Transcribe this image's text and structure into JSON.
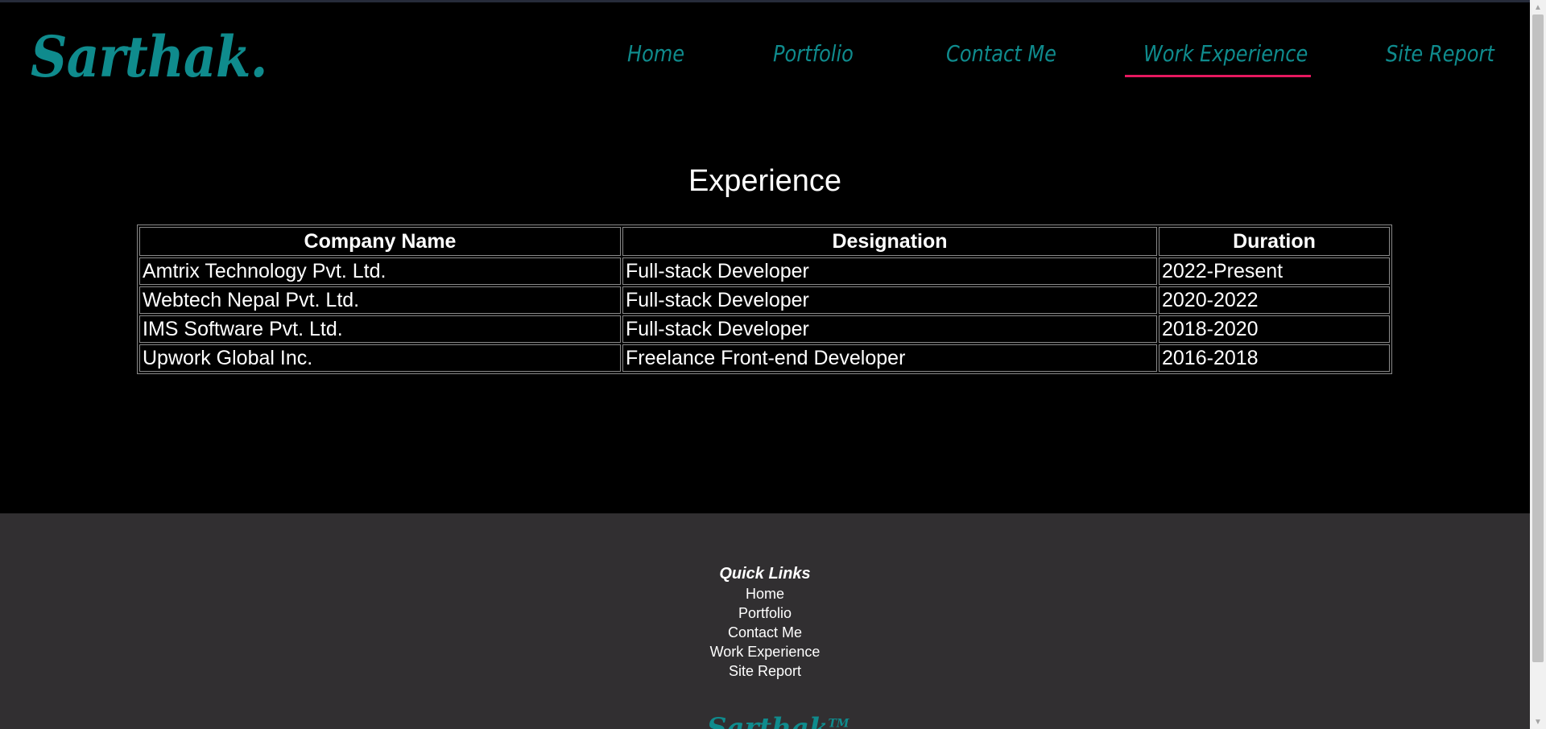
{
  "header": {
    "logo": "Sarthak.",
    "nav": [
      {
        "label": "Home"
      },
      {
        "label": "Portfolio"
      },
      {
        "label": "Contact Me"
      },
      {
        "label": "Work Experience",
        "active": true
      },
      {
        "label": "Site Report"
      }
    ]
  },
  "main": {
    "title": "Experience",
    "table": {
      "headers": [
        "Company Name",
        "Designation",
        "Duration"
      ],
      "rows": [
        [
          "Amtrix Technology Pvt. Ltd.",
          "Full-stack Developer",
          "2022-Present"
        ],
        [
          "Webtech Nepal Pvt. Ltd.",
          "Full-stack Developer",
          "2020-2022"
        ],
        [
          "IMS Software Pvt. Ltd.",
          "Full-stack Developer",
          "2018-2020"
        ],
        [
          "Upwork Global Inc.",
          "Freelance Front-end Developer",
          "2016-2018"
        ]
      ]
    }
  },
  "footer": {
    "heading": "Quick Links",
    "links": [
      "Home",
      "Portfolio",
      "Contact Me",
      "Work Experience",
      "Site Report"
    ],
    "logo": "Sarthak",
    "trademark": "TM"
  },
  "colors": {
    "accent": "#0f8b8d",
    "active_underline": "#e6185f",
    "background": "#000000",
    "footer_background": "#312f31"
  },
  "icons": {
    "scroll_up": "triangle-up-icon",
    "scroll_down": "triangle-down-icon"
  }
}
